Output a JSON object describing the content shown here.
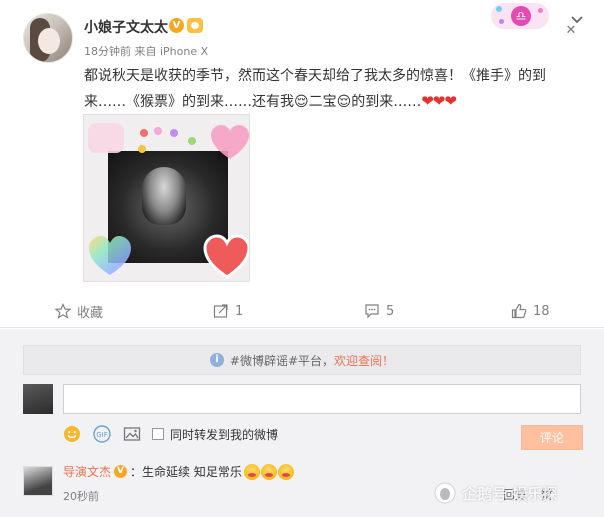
{
  "post": {
    "username": "小娘子文太太",
    "meta": "18分钟前 来自 iPhone X",
    "text": "都说秋天是收获的季节，然而这个春天却给了我太多的惊喜！《推手》的到来……《猴票》的到来……还有我",
    "text_mid": "二宝",
    "text_end": "的到来……",
    "hearts": "❤❤❤"
  },
  "actions": {
    "favorite_label": "收藏",
    "repost_count": "1",
    "comment_count": "5",
    "like_count": "18"
  },
  "comment_box": {
    "notice_prefix": "#微博辟谣#平台，",
    "notice_highlight": "欢迎查阅！",
    "input_value": "",
    "also_repost_label": "同时转发到我的微博",
    "submit_label": "评论"
  },
  "comments": [
    {
      "author": "导演文杰",
      "text": "：生命延续 知足常乐",
      "time": "20秒前",
      "reply_label": "回复",
      "like_label": "赞"
    }
  ],
  "watermark": {
    "text": "企鹅号 娱乐探"
  },
  "colors": {
    "accent": "#eb7350",
    "hearts": "#e8312f",
    "vip_badge": "#f6a623",
    "submit_disabled": "#ffc09f"
  },
  "icons": [
    "favorite-icon",
    "repost-icon",
    "comment-icon",
    "like-icon",
    "info-icon",
    "close-icon",
    "emoji-icon",
    "gif-icon",
    "image-icon",
    "chevron-down-icon"
  ]
}
